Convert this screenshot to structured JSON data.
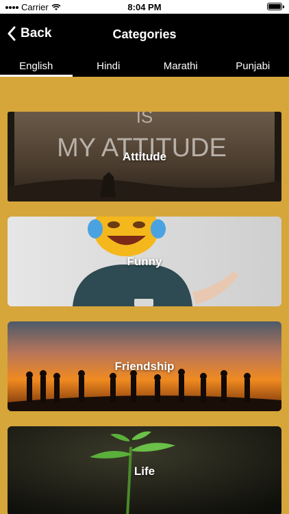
{
  "status_bar": {
    "carrier": "Carrier",
    "time": "8:04 PM",
    "battery_level": 1.0
  },
  "nav": {
    "back_label": "Back",
    "title": "Categories"
  },
  "tabs": [
    {
      "label": "English",
      "active": true
    },
    {
      "label": "Hindi",
      "active": false
    },
    {
      "label": "Marathi",
      "active": false
    },
    {
      "label": "Punjabi",
      "active": false
    }
  ],
  "categories": [
    {
      "label": "Attitude",
      "image_text": "MY ATTITUDE",
      "image_text_top": "IS"
    },
    {
      "label": "Funny"
    },
    {
      "label": "Friendship"
    },
    {
      "label": "Life"
    }
  ],
  "colors": {
    "background": "#d6a63b",
    "bar": "#000000",
    "text": "#ffffff"
  }
}
